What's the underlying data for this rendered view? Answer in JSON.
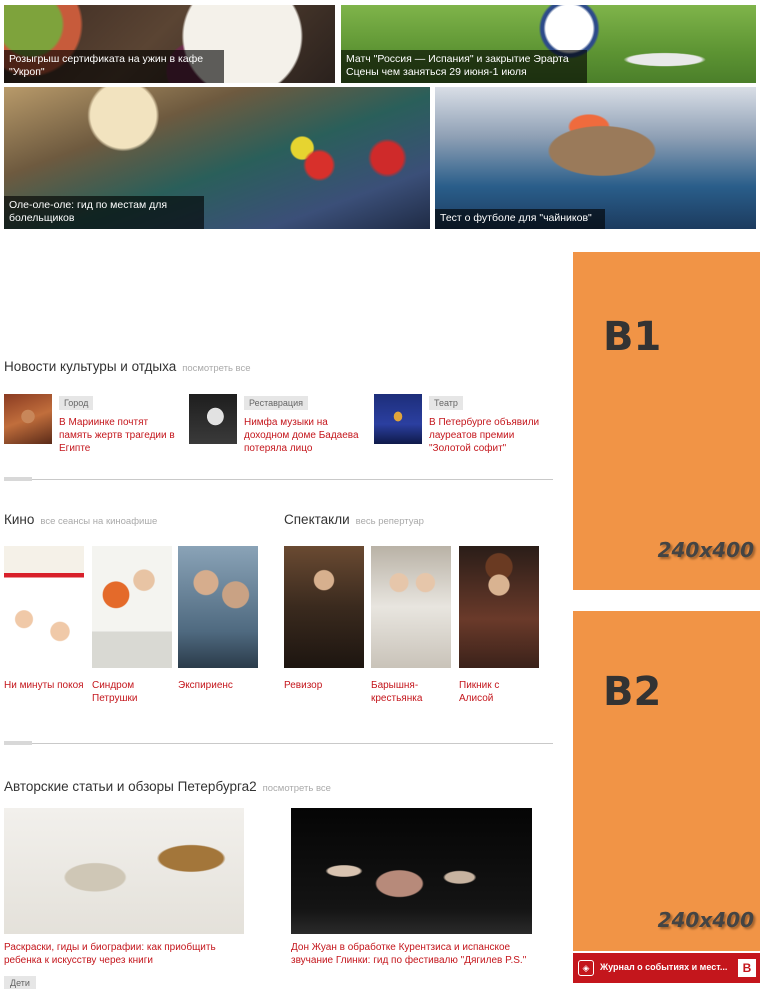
{
  "top_tiles": [
    {
      "caption": "Розыгрыш сертификата на ужин в кафе \"Укроп\""
    },
    {
      "caption_line1": "Матч \"Россия — Испания\" и закрытие Эрарта",
      "caption_line2": "Сцены чем заняться 29 июня-1 июля"
    },
    {
      "caption": "Оле-оле-оле: гид по местам для болельщиков"
    },
    {
      "caption": "Тест о футболе для \"чайников\""
    }
  ],
  "culture": {
    "title": "Новости культуры и отдыха",
    "see_all": "посмотреть все",
    "items": [
      {
        "tag": "Город",
        "title": "В Мариинке почтят память жертв трагедии в Египте"
      },
      {
        "tag": "Реставрация",
        "title": "Нимфа музыки на доходном доме Бадаева потеряла лицо"
      },
      {
        "tag": "Театр",
        "title": "В Петербурге объявили лауреатов премии \"Золотой софит\""
      }
    ]
  },
  "cinema": {
    "title": "Кино",
    "see_all": "все сеансы на киноафише",
    "items": [
      {
        "title": "Ни минуты покоя"
      },
      {
        "title": "Синдром Петрушки"
      },
      {
        "title": "Экспириенс"
      }
    ]
  },
  "plays": {
    "title": "Спектакли",
    "see_all": "весь репертуар",
    "items": [
      {
        "title": "Ревизор"
      },
      {
        "title": "Барышня-крестьянка"
      },
      {
        "title": "Пикник с Алисой"
      }
    ]
  },
  "authors": {
    "title": "Авторские статьи и обзоры Петербурга2",
    "see_all": "посмотреть все",
    "items": [
      {
        "title": "Раскраски, гиды и биографии: как приобщить ребенка к искусству через книги",
        "tag": "Дети"
      },
      {
        "title": "Дон Жуан в обработке Курентзиса и испанское звучание Глинки: гид по фестивалю \"Дягилев P.S.\""
      }
    ]
  },
  "ads": [
    {
      "label": "B1",
      "size": "240x400"
    },
    {
      "label": "B2",
      "size": "240x400"
    }
  ],
  "footer_bar": {
    "text": "Журнал о событиях и мест...",
    "badge": "B"
  },
  "colors": {
    "accent": "#c4161c",
    "ad": "#f19446"
  }
}
